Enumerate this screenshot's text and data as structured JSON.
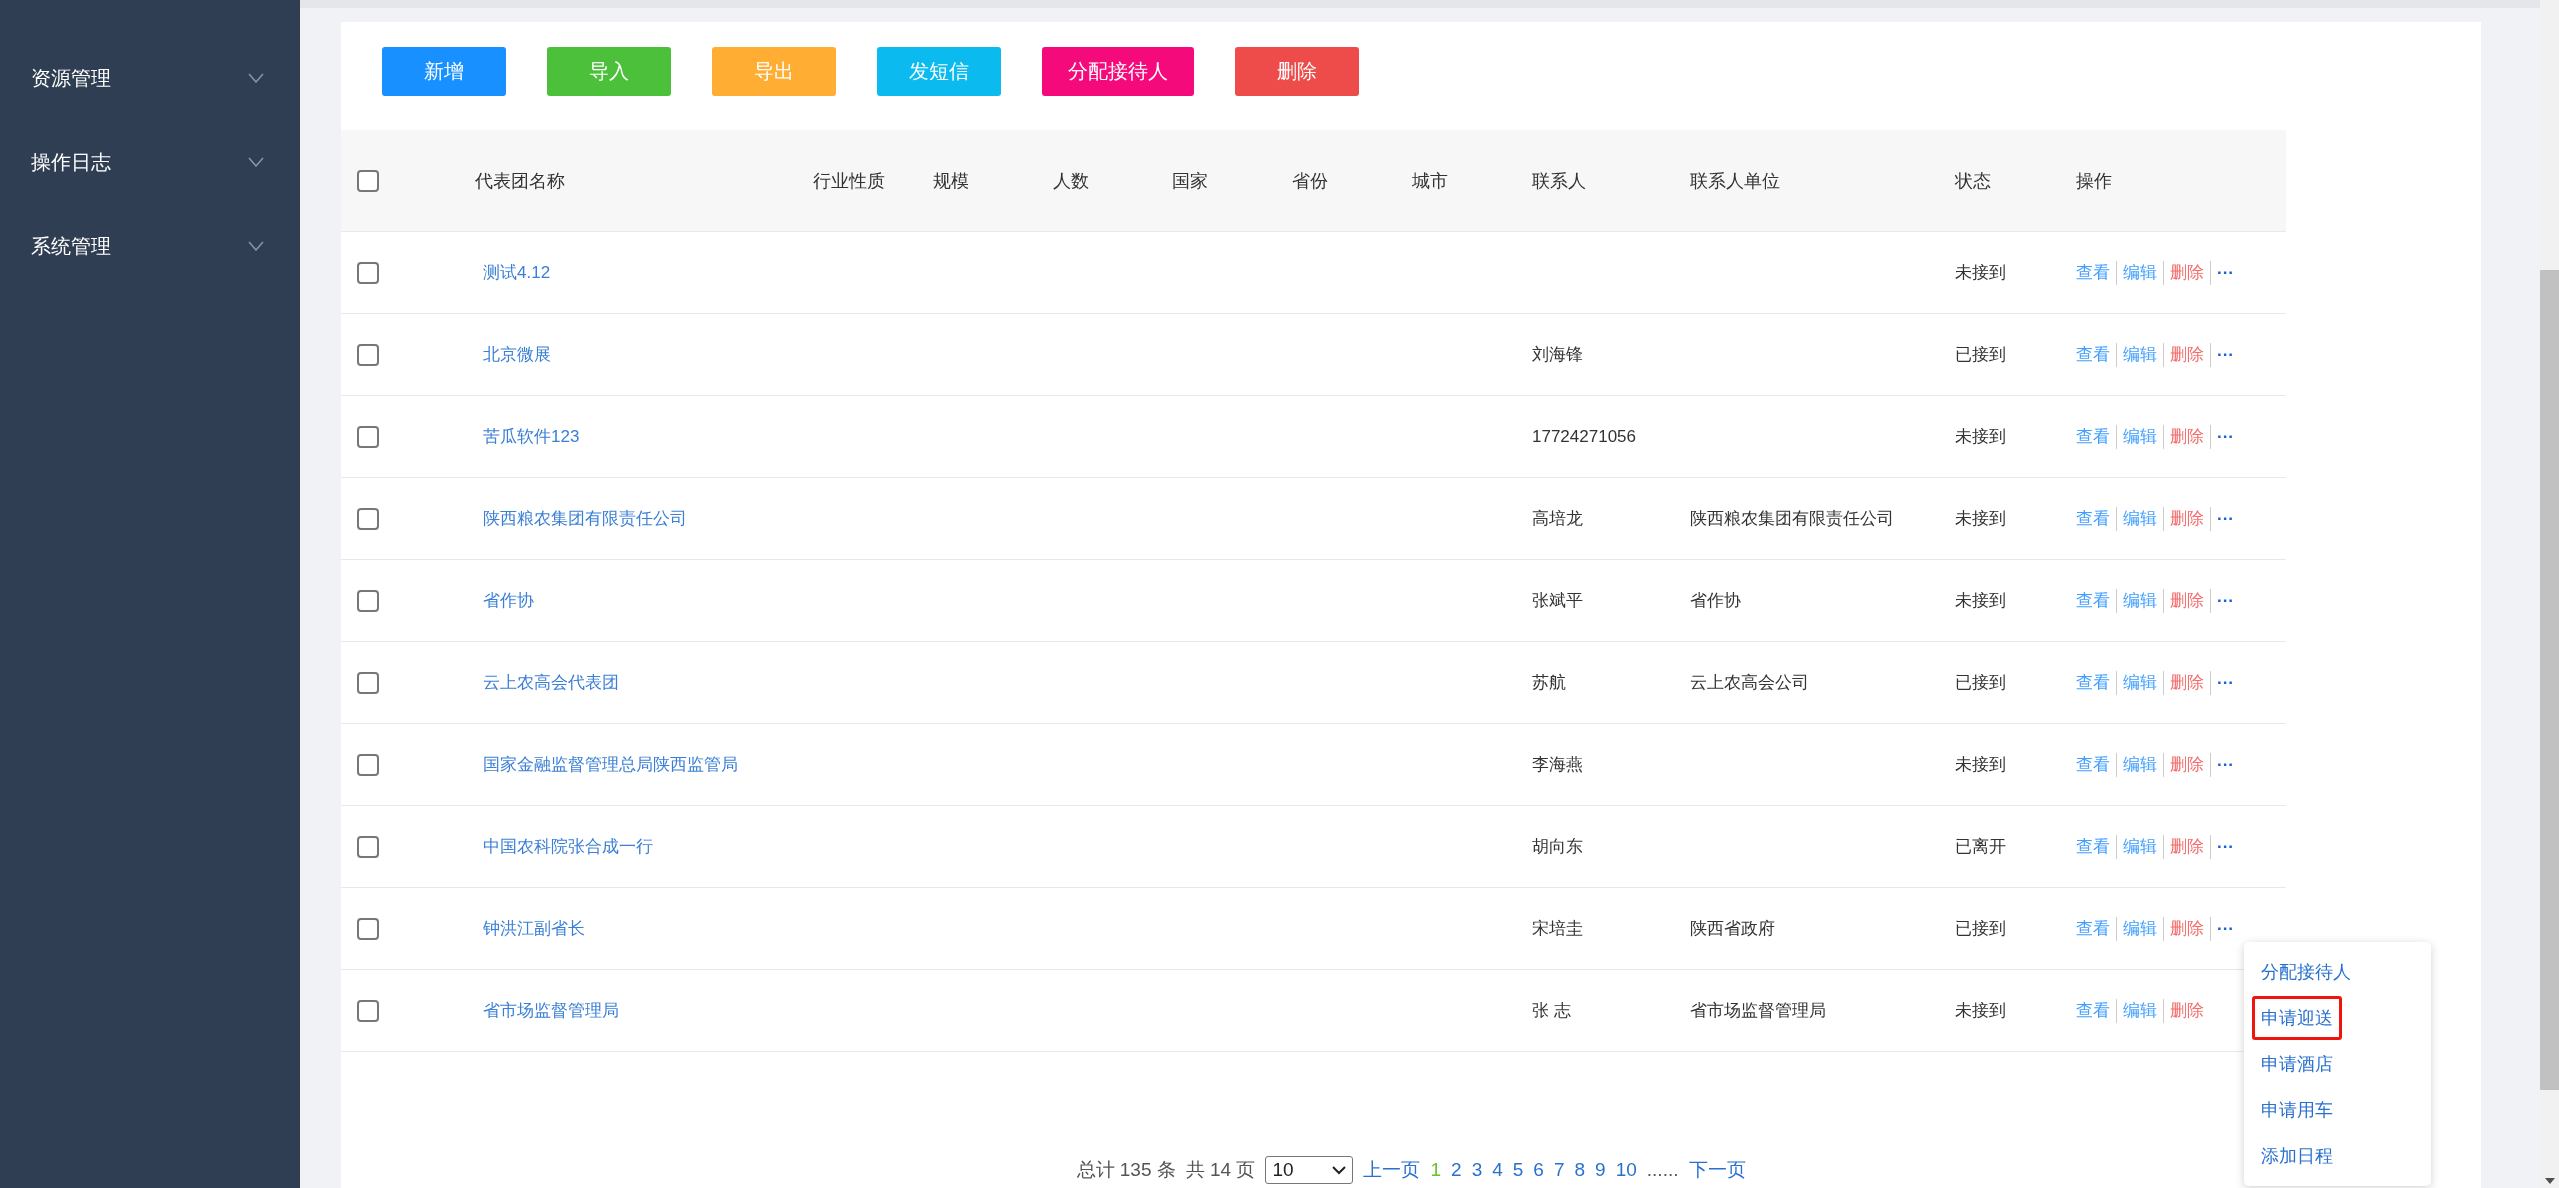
{
  "sidebar": {
    "items": [
      {
        "label": "资源管理",
        "expanded": false
      },
      {
        "label": "操作日志",
        "expanded": false
      },
      {
        "label": "系统管理",
        "expanded": false
      }
    ]
  },
  "toolbar": {
    "buttons": [
      {
        "label": "新增",
        "color": "#1890ff"
      },
      {
        "label": "导入",
        "color": "#4cc03a"
      },
      {
        "label": "导出",
        "color": "#ffad33"
      },
      {
        "label": "发短信",
        "color": "#0bbbf0"
      },
      {
        "label": "分配接待人",
        "color": "#f50a7c"
      },
      {
        "label": "删除",
        "color": "#ee4b4b"
      }
    ]
  },
  "table": {
    "select_all": {
      "checked": false
    },
    "columns": [
      "代表团名称",
      "行业性质",
      "规模",
      "人数",
      "国家",
      "省份",
      "城市",
      "联系人",
      "联系人单位",
      "状态",
      "操作"
    ],
    "rows": [
      {
        "checked": false,
        "name": "测试4.12",
        "contact": "",
        "unit": "",
        "status": "未接到",
        "actions": [
          {
            "label": "查看",
            "kind": "link"
          },
          {
            "label": "编辑",
            "kind": "link"
          },
          {
            "label": "删除",
            "kind": "danger"
          },
          {
            "label": "···",
            "kind": "more"
          }
        ]
      },
      {
        "checked": false,
        "name": "北京微展",
        "contact": "刘海锋",
        "unit": "",
        "status": "已接到",
        "actions": [
          {
            "label": "查看",
            "kind": "link"
          },
          {
            "label": "编辑",
            "kind": "link"
          },
          {
            "label": "删除",
            "kind": "danger"
          },
          {
            "label": "···",
            "kind": "more"
          }
        ]
      },
      {
        "checked": false,
        "name": "苦瓜软件123",
        "contact": "17724271056",
        "unit": "",
        "status": "未接到",
        "actions": [
          {
            "label": "查看",
            "kind": "link"
          },
          {
            "label": "编辑",
            "kind": "link"
          },
          {
            "label": "删除",
            "kind": "danger"
          },
          {
            "label": "···",
            "kind": "more"
          }
        ]
      },
      {
        "checked": false,
        "name": "陕西粮农集团有限责任公司",
        "contact": "高培龙",
        "unit": "陕西粮农集团有限责任公司",
        "status": "未接到",
        "actions": [
          {
            "label": "查看",
            "kind": "link"
          },
          {
            "label": "编辑",
            "kind": "link"
          },
          {
            "label": "删除",
            "kind": "danger"
          },
          {
            "label": "···",
            "kind": "more"
          }
        ]
      },
      {
        "checked": false,
        "name": "省作协",
        "contact": "张斌平",
        "unit": "省作协",
        "status": "未接到",
        "actions": [
          {
            "label": "查看",
            "kind": "link"
          },
          {
            "label": "编辑",
            "kind": "link"
          },
          {
            "label": "删除",
            "kind": "danger"
          },
          {
            "label": "···",
            "kind": "more"
          }
        ]
      },
      {
        "checked": false,
        "name": "云上农高会代表团",
        "contact": "苏航",
        "unit": "云上农高会公司",
        "status": "已接到",
        "actions": [
          {
            "label": "查看",
            "kind": "link"
          },
          {
            "label": "编辑",
            "kind": "link"
          },
          {
            "label": "删除",
            "kind": "danger"
          },
          {
            "label": "···",
            "kind": "more"
          }
        ]
      },
      {
        "checked": false,
        "name": "国家金融监督管理总局陕西监管局",
        "contact": "李海燕",
        "unit": "",
        "status": "未接到",
        "actions": [
          {
            "label": "查看",
            "kind": "link"
          },
          {
            "label": "编辑",
            "kind": "link"
          },
          {
            "label": "删除",
            "kind": "danger"
          },
          {
            "label": "···",
            "kind": "more"
          }
        ]
      },
      {
        "checked": false,
        "name": "中国农科院张合成一行",
        "contact": "胡向东",
        "unit": "",
        "status": "已离开",
        "actions": [
          {
            "label": "查看",
            "kind": "link"
          },
          {
            "label": "编辑",
            "kind": "link"
          },
          {
            "label": "删除",
            "kind": "danger"
          },
          {
            "label": "···",
            "kind": "more"
          }
        ]
      },
      {
        "checked": false,
        "name": "钟洪江副省长",
        "contact": "宋培圭",
        "unit": "陕西省政府",
        "status": "已接到",
        "actions": [
          {
            "label": "查看",
            "kind": "link"
          },
          {
            "label": "编辑",
            "kind": "link"
          },
          {
            "label": "删除",
            "kind": "danger"
          },
          {
            "label": "···",
            "kind": "more"
          }
        ],
        "menu": [
          {
            "label": "分配接待人",
            "highlighted": false
          },
          {
            "label": "申请迎送",
            "highlighted": true
          },
          {
            "label": "申请酒店",
            "highlighted": false
          },
          {
            "label": "申请用车",
            "highlighted": false
          },
          {
            "label": "添加日程",
            "highlighted": false
          }
        ]
      },
      {
        "checked": false,
        "name": "省市场监督管理局",
        "contact": "张 志",
        "unit": "省市场监督管理局",
        "status": "未接到",
        "actions": [
          {
            "label": "查看",
            "kind": "link"
          },
          {
            "label": "编辑",
            "kind": "link"
          },
          {
            "label": "删除",
            "kind": "danger"
          }
        ]
      }
    ]
  },
  "pagination": {
    "total": "总计 135 条",
    "pages": "共 14 页",
    "page_size": "10",
    "prev": "上一页",
    "page_links": [
      {
        "label": "1",
        "selected": true
      },
      {
        "label": "2",
        "selected": false
      },
      {
        "label": "3",
        "selected": false
      },
      {
        "label": "4",
        "selected": false
      },
      {
        "label": "5",
        "selected": false
      },
      {
        "label": "6",
        "selected": false
      },
      {
        "label": "7",
        "selected": false
      },
      {
        "label": "8",
        "selected": false
      },
      {
        "label": "9",
        "selected": false
      },
      {
        "label": "10",
        "selected": false
      }
    ],
    "ellipsis": "......",
    "next": "下一页"
  }
}
